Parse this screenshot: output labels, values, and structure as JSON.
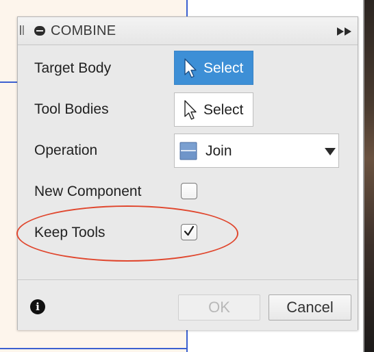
{
  "dialog": {
    "title": "COMBINE",
    "icons": {
      "grip": "drag-grip-icon",
      "combine": "combine-icon",
      "expand": "double-chevron-right-icon"
    }
  },
  "fields": {
    "target_body": {
      "label": "Target Body",
      "button_label": "Select",
      "state": "active"
    },
    "tool_bodies": {
      "label": "Tool Bodies",
      "button_label": "Select",
      "state": "normal"
    },
    "operation": {
      "label": "Operation",
      "selected": "Join"
    },
    "new_component": {
      "label": "New Component",
      "checked": false
    },
    "keep_tools": {
      "label": "Keep Tools",
      "checked": true
    }
  },
  "footer": {
    "ok_label": "OK",
    "ok_enabled": false,
    "cancel_label": "Cancel"
  },
  "colors": {
    "accent_blue": "#3d8fd6",
    "highlight_red": "#e0462d",
    "canvas_border_blue": "#3b5fd0"
  }
}
